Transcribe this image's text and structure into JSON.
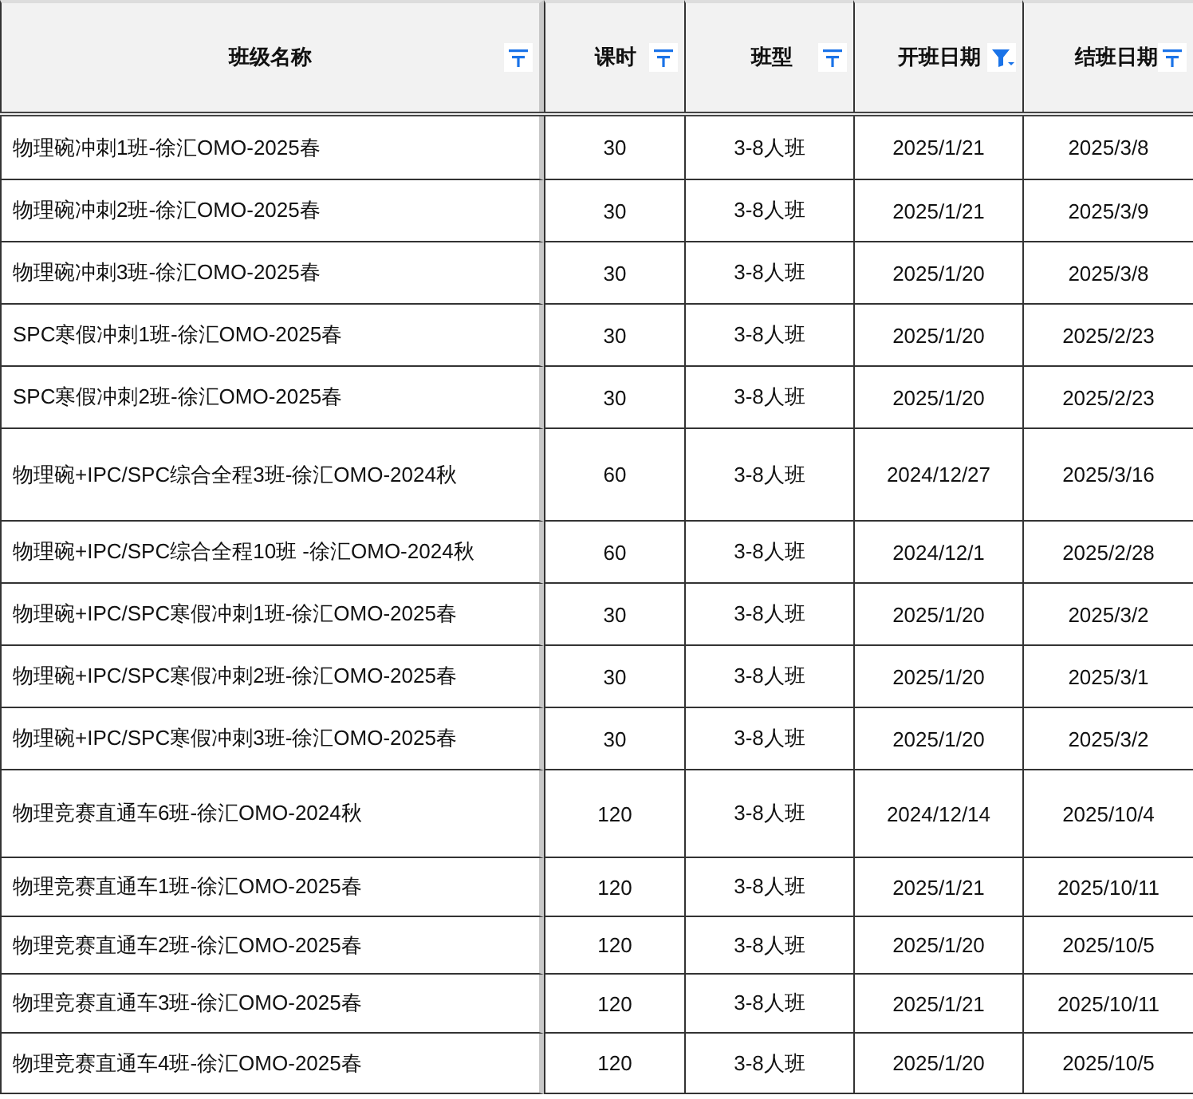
{
  "table": {
    "columns": [
      {
        "label": "班级名称",
        "filtered": false
      },
      {
        "label": "课时",
        "filtered": false
      },
      {
        "label": "班型",
        "filtered": false
      },
      {
        "label": "开班日期",
        "filtered": true
      },
      {
        "label": "结班日期",
        "filtered": false
      }
    ],
    "rows": [
      [
        "物理碗冲刺1班-徐汇OMO-2025春",
        "30",
        "3-8人班",
        "2025/1/21",
        "2025/3/8"
      ],
      [
        "物理碗冲刺2班-徐汇OMO-2025春",
        "30",
        "3-8人班",
        "2025/1/21",
        "2025/3/9"
      ],
      [
        "物理碗冲刺3班-徐汇OMO-2025春",
        "30",
        "3-8人班",
        "2025/1/20",
        "2025/3/8"
      ],
      [
        "SPC寒假冲刺1班-徐汇OMO-2025春",
        "30",
        "3-8人班",
        "2025/1/20",
        "2025/2/23"
      ],
      [
        "SPC寒假冲刺2班-徐汇OMO-2025春",
        "30",
        "3-8人班",
        "2025/1/20",
        "2025/2/23"
      ],
      [
        "物理碗+IPC/SPC综合全程3班-徐汇OMO-2024秋",
        "60",
        "3-8人班",
        "2024/12/27",
        "2025/3/16"
      ],
      [
        "物理碗+IPC/SPC综合全程10班 -徐汇OMO-2024秋",
        "60",
        "3-8人班",
        "2024/12/1",
        "2025/2/28"
      ],
      [
        "物理碗+IPC/SPC寒假冲刺1班-徐汇OMO-2025春",
        "30",
        "3-8人班",
        "2025/1/20",
        "2025/3/2"
      ],
      [
        "物理碗+IPC/SPC寒假冲刺2班-徐汇OMO-2025春",
        "30",
        "3-8人班",
        "2025/1/20",
        "2025/3/1"
      ],
      [
        "物理碗+IPC/SPC寒假冲刺3班-徐汇OMO-2025春",
        "30",
        "3-8人班",
        "2025/1/20",
        "2025/3/2"
      ],
      [
        "物理竞赛直通车6班-徐汇OMO-2024秋",
        "120",
        "3-8人班",
        "2024/12/14",
        "2025/10/4"
      ],
      [
        "物理竞赛直通车1班-徐汇OMO-2025春",
        "120",
        "3-8人班",
        "2025/1/21",
        "2025/10/11"
      ],
      [
        "物理竞赛直通车2班-徐汇OMO-2025春",
        "120",
        "3-8人班",
        "2025/1/20",
        "2025/10/5"
      ],
      [
        "物理竞赛直通车3班-徐汇OMO-2025春",
        "120",
        "3-8人班",
        "2025/1/21",
        "2025/10/11"
      ],
      [
        "物理竞赛直通车4班-徐汇OMO-2025春",
        "120",
        "3-8人班",
        "2025/1/20",
        "2025/10/5"
      ]
    ]
  }
}
